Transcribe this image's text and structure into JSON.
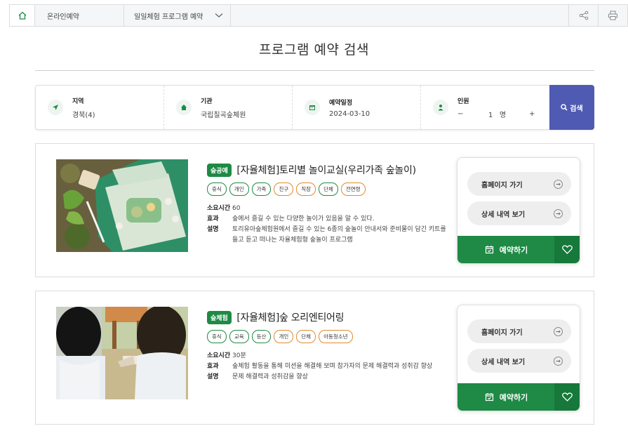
{
  "breadcrumb": {
    "level1": "온라인예약",
    "level2": "일일체험 프로그램 예약"
  },
  "page_title": "프로그램 예약 검색",
  "search": {
    "region_label": "지역",
    "region_value": "경북(4)",
    "org_label": "기관",
    "org_value": "국립칠곡숲체원",
    "date_label": "예약일정",
    "date_value": "2024-03-10",
    "people_label": "인원",
    "people_minus": "−",
    "people_count": "1",
    "people_unit": "명",
    "people_plus": "+",
    "button_label": "검색"
  },
  "programs": [
    {
      "category": "숲공예",
      "title": "[자율체험]토리별 놀이교실(우리가족 숲놀이)",
      "tags": [
        {
          "label": "휴식",
          "color": "#1e8a45"
        },
        {
          "label": "개인",
          "color": "#1e8a45"
        },
        {
          "label": "가족",
          "color": "#1e8a45"
        },
        {
          "label": "친구",
          "color": "#e28a2b"
        },
        {
          "label": "직장",
          "color": "#e28a2b"
        },
        {
          "label": "단체",
          "color": "#1e8a45"
        },
        {
          "label": "전연령",
          "color": "#e28a2b"
        }
      ],
      "duration_label": "소요시간",
      "duration": "60",
      "effect_label": "효과",
      "effect": "숲에서 즐길 수 있는 다양한 놀이가 있음을 알 수 있다.",
      "desc_label": "설명",
      "desc": "토리유아숲체험원에서 즐길 수 있는 6종의 숲놀이 안내서와 준비물이 담긴 키트를 들고 듣고 떠나는 자율체험형 숲놀이 프로그램",
      "homepage_label": "홈페이지 가기",
      "detail_label": "상세 내역 보기",
      "reserve_label": "예약하기"
    },
    {
      "category": "숲체험",
      "title": "[자율체험]숲 오리엔티어링",
      "tags": [
        {
          "label": "휴식",
          "color": "#1e8a45"
        },
        {
          "label": "교육",
          "color": "#1e8a45"
        },
        {
          "label": "등산",
          "color": "#1e8a45"
        },
        {
          "label": "개인",
          "color": "#e28a2b"
        },
        {
          "label": "단체",
          "color": "#e28a2b"
        },
        {
          "label": "아동청소년",
          "color": "#e28a2b"
        }
      ],
      "duration_label": "소요시간",
      "duration": "30분",
      "effect_label": "효과",
      "effect": "숲체험 활동을 통해 미션을 해결해 보며 참가자의 문제 해결력과 성취감 향상",
      "desc_label": "설명",
      "desc": "문제 해결력과 성취감을 향상",
      "homepage_label": "홈페이지 가기",
      "detail_label": "상세 내역 보기",
      "reserve_label": "예약하기"
    }
  ],
  "colors": {
    "accent_green": "#1e8a45",
    "search_button": "#4f5bb3",
    "tag_orange": "#e28a2b"
  }
}
